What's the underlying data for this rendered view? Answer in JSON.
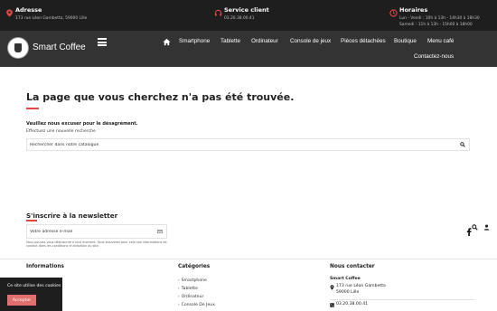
{
  "topbar": {
    "address": {
      "title": "Adresse",
      "line1": "173 rue Léon Gambetta, 59000 Lille"
    },
    "service": {
      "title": "Service client",
      "line1": "03.20.38.00.41"
    },
    "hours": {
      "title": "Horaires",
      "line1": "Lun - Vendi : 10h à 13h - 14h30 à 18h30",
      "line2": "Samedi : 11h à 13h - 15h00 à 18h00"
    }
  },
  "brand": {
    "name": "Smart Coffee"
  },
  "nav": {
    "items": [
      "Smartphone",
      "Tablette",
      "Ordinateur",
      "Console de jeux",
      "Pièces détachées",
      "Boutique",
      "Menu café"
    ],
    "contact": "Contactez-nous"
  },
  "notfound": {
    "heading": "La page que vous cherchez n'a pas été trouvée.",
    "excuse": "Veuillez nous excuser pour le désagrément.",
    "effect": "Effectuez une nouvelle recherche",
    "search_placeholder": "Rechercher dans notre catalogue"
  },
  "newsletter": {
    "title": "S'inscrire à la newsletter",
    "placeholder": "Votre adresse e-mail",
    "note": "Vous pouvez vous désinscrire à tout moment. Vous trouverez pour cela nos informations de contact dans les conditions d'utilisation du site."
  },
  "footer": {
    "info_title": "Informations",
    "categories_title": "Catégories",
    "categories": [
      "Smartphone",
      "Tablette",
      "Ordinateur",
      "Console De Jeux"
    ],
    "contact_title": "Nous contacter",
    "company": "Smart Coffee",
    "address_line1": "173 rue Léon Gambetta",
    "address_line2": "59000 Lille",
    "phone": "03.20.38.00.41"
  },
  "cookie": {
    "text": "Ce site utilise des cookies",
    "button": "Accepter"
  },
  "colors": {
    "accent": "#e04848",
    "dark": "#1e1e1e",
    "nav": "#333333",
    "button": "#e26f6f"
  }
}
